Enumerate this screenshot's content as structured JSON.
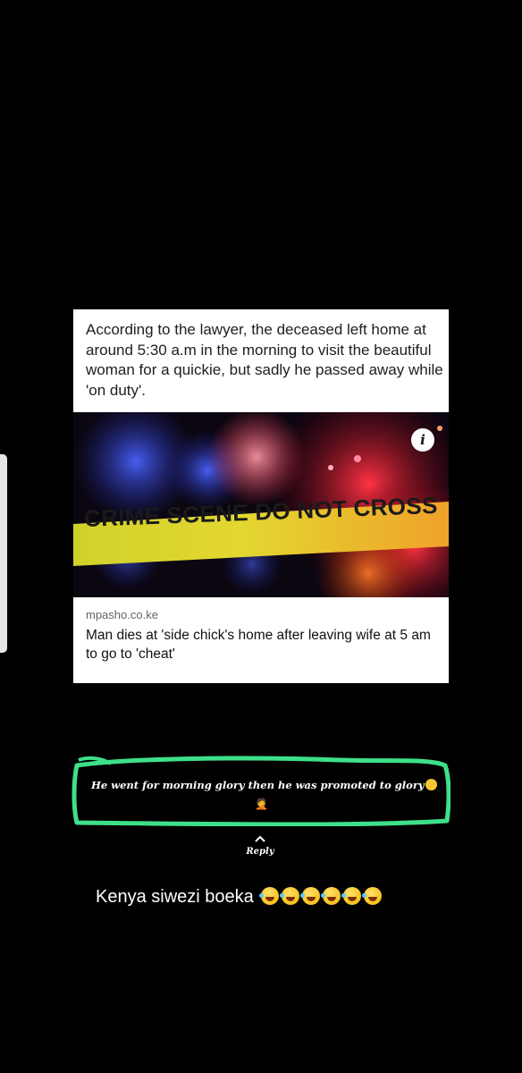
{
  "article_card": {
    "quote": "According to the lawyer, the deceased left home at around 5:30 a.m in the morning to visit the beautiful woman for a quickie, but sadly he passed away while 'on duty'.",
    "image": {
      "tape_text": "CRIME SCENE DO NOT CROSS",
      "info_icon": "info-icon",
      "info_label": "i"
    },
    "source": "mpasho.co.ke",
    "headline": "Man dies at 'side chick's home after leaving wife at 5 am to go to 'cheat'"
  },
  "comment": {
    "text": "He went for morning glory then he was promoted to glory",
    "trailing_emoji": "grimacing-face-emoji",
    "second_line_emoji": "person-facepalming-emoji",
    "highlight_color": "#3ee08a",
    "reply_icon": "chevron-up-icon",
    "reply_label": "Reply"
  },
  "caption": {
    "text": "Kenya siwezi boeka",
    "emoji": "rolling-on-the-floor-laughing-emoji",
    "emoji_count": 6
  },
  "colors": {
    "background": "#000000",
    "tape": "#d9d21e",
    "highlight": "#3ee08a"
  }
}
